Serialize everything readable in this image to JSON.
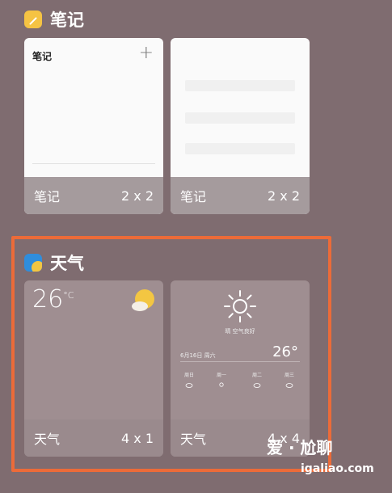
{
  "notes_section": {
    "title": "笔记",
    "cards": [
      {
        "header": "笔记",
        "label": "笔记",
        "size": "2 x 2"
      },
      {
        "label": "笔记",
        "size": "2 x 2"
      }
    ]
  },
  "weather_section": {
    "title": "天气",
    "card_small": {
      "temp": "26",
      "unit": "°C",
      "label": "天气",
      "size": "4 x 1"
    },
    "card_large": {
      "condition": "晴  空气良好",
      "date": "6月16日 周六",
      "temp": "26°",
      "forecast": [
        {
          "day": "周日"
        },
        {
          "day": "周一"
        },
        {
          "day": "周二"
        },
        {
          "day": "周三"
        }
      ],
      "label": "天气",
      "size": "4 x 4"
    }
  },
  "colors": {
    "highlight_frame": "#ec6b39",
    "background": "#7f6c70"
  },
  "watermark": {
    "line1": "爱 · 尬聊",
    "line2": "igaliao.com"
  }
}
